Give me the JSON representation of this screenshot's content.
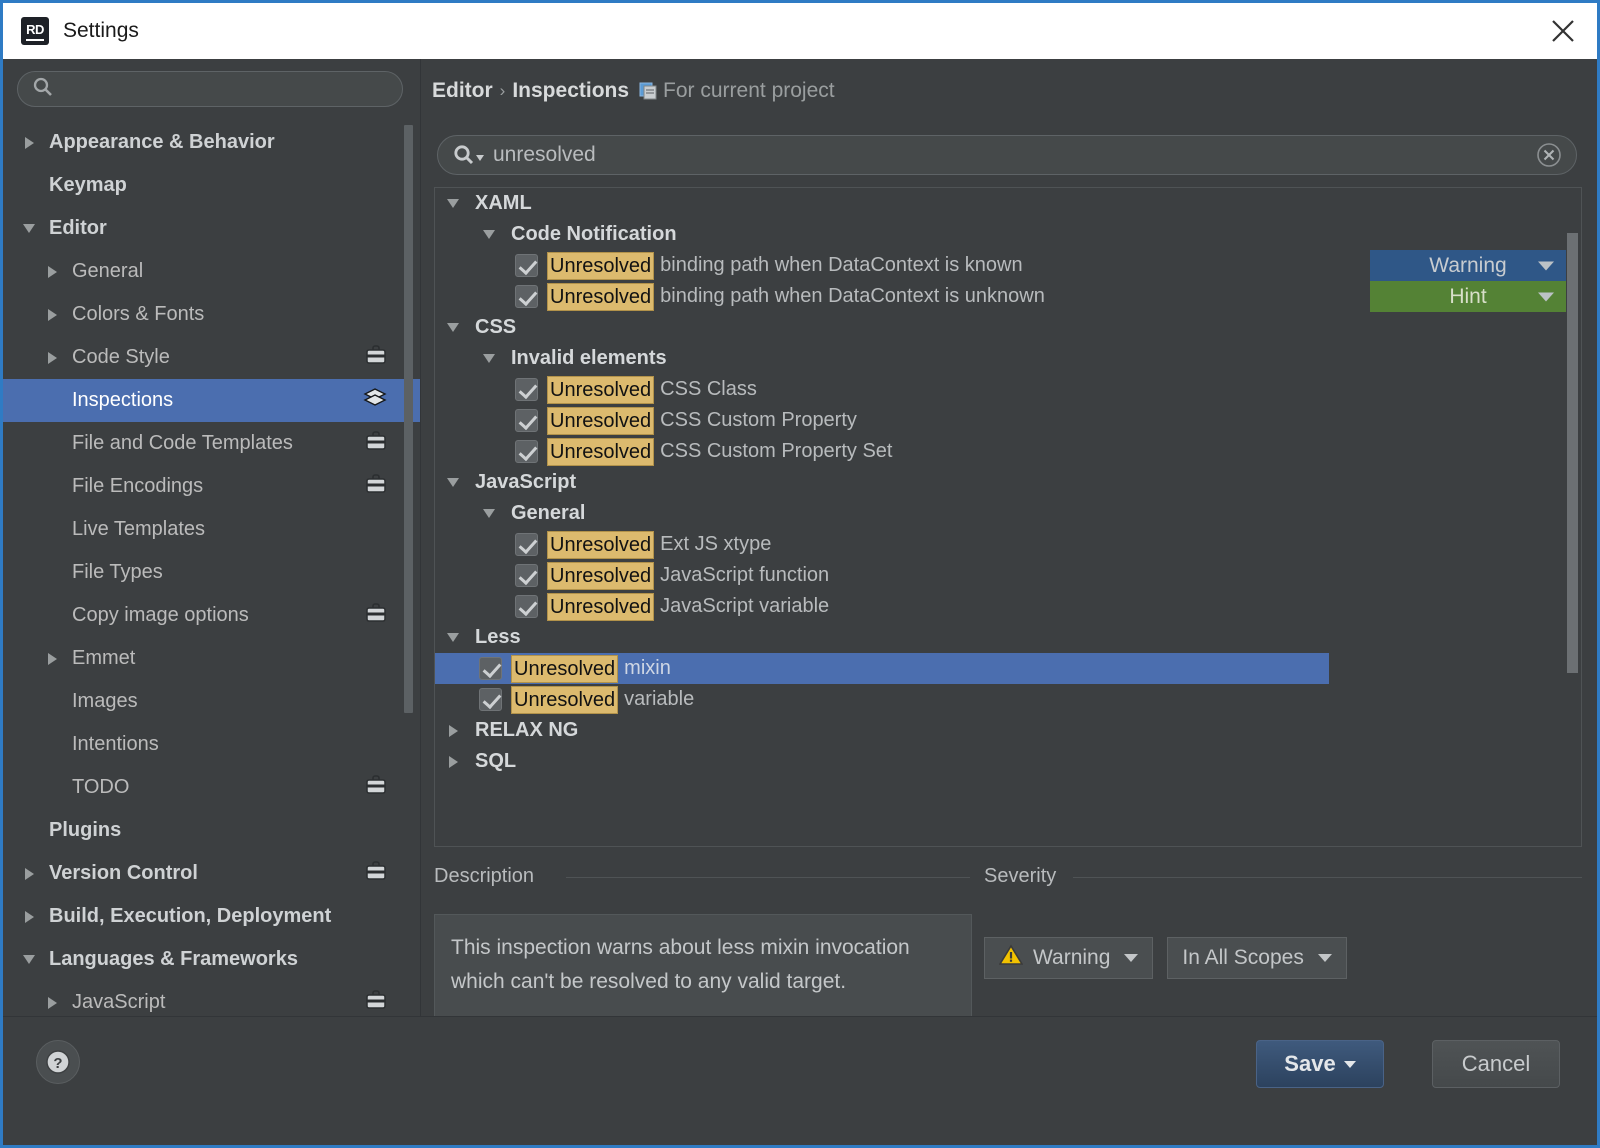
{
  "window": {
    "title": "Settings",
    "logo_text": "RD",
    "close_icon": "close-icon"
  },
  "sidebar": {
    "search_placeholder": "",
    "search_value": "",
    "items": [
      {
        "label": "Appearance & Behavior",
        "level": 0,
        "arrow": "right",
        "bold": true,
        "badge": ""
      },
      {
        "label": "Keymap",
        "level": 0,
        "arrow": "none",
        "bold": true,
        "badge": ""
      },
      {
        "label": "Editor",
        "level": 0,
        "arrow": "down",
        "bold": true,
        "badge": ""
      },
      {
        "label": "General",
        "level": 1,
        "arrow": "right",
        "bold": false,
        "badge": ""
      },
      {
        "label": "Colors & Fonts",
        "level": 1,
        "arrow": "right",
        "bold": false,
        "badge": ""
      },
      {
        "label": "Code Style",
        "level": 1,
        "arrow": "right",
        "bold": false,
        "badge": "briefcase-icon"
      },
      {
        "label": "Inspections",
        "level": 1,
        "arrow": "none",
        "bold": false,
        "badge": "layers-icon",
        "selected": true
      },
      {
        "label": "File and Code Templates",
        "level": 1,
        "arrow": "none",
        "bold": false,
        "badge": "briefcase-icon"
      },
      {
        "label": "File Encodings",
        "level": 1,
        "arrow": "none",
        "bold": false,
        "badge": "briefcase-icon"
      },
      {
        "label": "Live Templates",
        "level": 1,
        "arrow": "none",
        "bold": false,
        "badge": ""
      },
      {
        "label": "File Types",
        "level": 1,
        "arrow": "none",
        "bold": false,
        "badge": ""
      },
      {
        "label": "Copy image options",
        "level": 1,
        "arrow": "none",
        "bold": false,
        "badge": "briefcase-icon"
      },
      {
        "label": "Emmet",
        "level": 1,
        "arrow": "right",
        "bold": false,
        "badge": ""
      },
      {
        "label": "Images",
        "level": 1,
        "arrow": "none",
        "bold": false,
        "badge": ""
      },
      {
        "label": "Intentions",
        "level": 1,
        "arrow": "none",
        "bold": false,
        "badge": ""
      },
      {
        "label": "TODO",
        "level": 1,
        "arrow": "none",
        "bold": false,
        "badge": "briefcase-icon"
      },
      {
        "label": "Plugins",
        "level": 0,
        "arrow": "none",
        "bold": true,
        "badge": ""
      },
      {
        "label": "Version Control",
        "level": 0,
        "arrow": "right",
        "bold": true,
        "badge": "briefcase-icon"
      },
      {
        "label": "Build, Execution, Deployment",
        "level": 0,
        "arrow": "right",
        "bold": true,
        "badge": ""
      },
      {
        "label": "Languages & Frameworks",
        "level": 0,
        "arrow": "down",
        "bold": true,
        "badge": ""
      },
      {
        "label": "JavaScript",
        "level": 1,
        "arrow": "right",
        "bold": false,
        "badge": "briefcase-icon"
      }
    ]
  },
  "breadcrumb": {
    "root": "Editor",
    "separator": "›",
    "page": "Inspections",
    "scope_icon": "copy-profile-icon",
    "scope": "For current project"
  },
  "search": {
    "value": "unresolved",
    "icon": "search-icon",
    "clear_icon": "clear-icon"
  },
  "tree": {
    "rows": [
      {
        "kind": "group",
        "level": 0,
        "arrow": "down",
        "label": "XAML"
      },
      {
        "kind": "group",
        "level": 1,
        "arrow": "down",
        "label": "Code Notification"
      },
      {
        "kind": "item",
        "level": 2,
        "checked": true,
        "highlight": "Unresolved",
        "rest": "binding path when DataContext is known",
        "severity": "Warning",
        "severity_color": "#2f5787"
      },
      {
        "kind": "item",
        "level": 2,
        "checked": true,
        "highlight": "Unresolved",
        "rest": "binding path when DataContext is unknown",
        "severity": "Hint",
        "severity_color": "#548235"
      },
      {
        "kind": "group",
        "level": 0,
        "arrow": "down",
        "label": "CSS"
      },
      {
        "kind": "group",
        "level": 1,
        "arrow": "down",
        "label": "Invalid elements"
      },
      {
        "kind": "item",
        "level": 2,
        "checked": true,
        "highlight": "Unresolved",
        "rest": "CSS Class"
      },
      {
        "kind": "item",
        "level": 2,
        "checked": true,
        "highlight": "Unresolved",
        "rest": "CSS Custom Property"
      },
      {
        "kind": "item",
        "level": 2,
        "checked": true,
        "highlight": "Unresolved",
        "rest": "CSS Custom Property Set"
      },
      {
        "kind": "group",
        "level": 0,
        "arrow": "down",
        "label": "JavaScript"
      },
      {
        "kind": "group",
        "level": 1,
        "arrow": "down",
        "label": "General"
      },
      {
        "kind": "item",
        "level": 2,
        "checked": true,
        "highlight": "Unresolved",
        "rest": "Ext JS xtype"
      },
      {
        "kind": "item",
        "level": 2,
        "checked": true,
        "highlight": "Unresolved",
        "rest": "JavaScript function"
      },
      {
        "kind": "item",
        "level": 2,
        "checked": true,
        "highlight": "Unresolved",
        "rest": "JavaScript variable"
      },
      {
        "kind": "group",
        "level": 0,
        "arrow": "down",
        "label": "Less"
      },
      {
        "kind": "item",
        "level": 1,
        "checked": true,
        "highlight": "Unresolved",
        "rest": "mixin",
        "selected": true
      },
      {
        "kind": "item",
        "level": 1,
        "checked": true,
        "highlight": "Unresolved",
        "rest": "variable"
      },
      {
        "kind": "group",
        "level": 0,
        "arrow": "right",
        "label": "RELAX NG"
      },
      {
        "kind": "group",
        "level": 0,
        "arrow": "right",
        "label": "SQL"
      }
    ]
  },
  "description": {
    "label": "Description",
    "text": "This inspection warns about less mixin invocation which can't be resolved to any valid target."
  },
  "severity": {
    "label": "Severity",
    "level": "Warning",
    "level_icon": "warning-triangle-icon",
    "scope": "In All Scopes"
  },
  "footer": {
    "help_label": "?",
    "save_label": "Save",
    "cancel_label": "Cancel"
  },
  "colors": {
    "accent_blue": "#4b6eaf",
    "highlight_gold": "#dcba6e",
    "severity_warning": "#2f5787",
    "severity_hint": "#548235",
    "window_border": "#2f7bc4"
  }
}
